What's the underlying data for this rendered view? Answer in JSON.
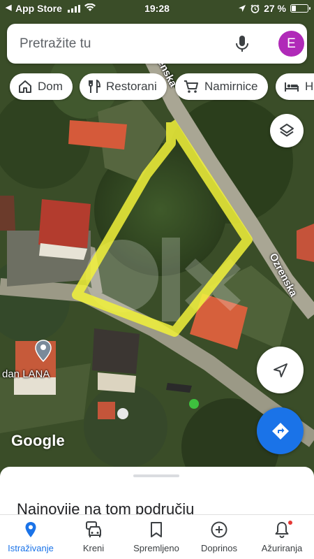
{
  "status_bar": {
    "back_arrow": "◀",
    "back_app": "App Store",
    "time": "19:28",
    "battery_percent": "27 %",
    "battery_level": 0.27
  },
  "search": {
    "placeholder": "Pretražite tu",
    "avatar_letter": "E",
    "avatar_color": "#b02ab8"
  },
  "chips": [
    {
      "label": "Dom",
      "icon": "home-icon"
    },
    {
      "label": "Restorani",
      "icon": "restaurant-icon"
    },
    {
      "label": "Namirnice",
      "icon": "shopping-cart-icon"
    },
    {
      "label": "Ho",
      "icon": "hotel-bed-icon"
    }
  ],
  "map": {
    "street_ozrenska": "Ozrenska",
    "street_upper": "enska",
    "place_label": "dan LANA",
    "logo": "Google",
    "outline_color": "#f2f23a"
  },
  "fabs": {
    "layers_icon": "layers-icon",
    "location_icon": "navigation-arrow-icon",
    "directions_icon": "directions-icon",
    "accent": "#1a73e8"
  },
  "sheet": {
    "title": "Najnovije na tom području"
  },
  "nav": [
    {
      "label": "Istraživanje",
      "icon": "explore-pin-icon",
      "active": true
    },
    {
      "label": "Kreni",
      "icon": "commute-car-icon",
      "active": false
    },
    {
      "label": "Spremljeno",
      "icon": "bookmark-icon",
      "active": false
    },
    {
      "label": "Doprinos",
      "icon": "add-circle-icon",
      "active": false
    },
    {
      "label": "Ažuriranja",
      "icon": "bell-icon",
      "active": false
    }
  ]
}
